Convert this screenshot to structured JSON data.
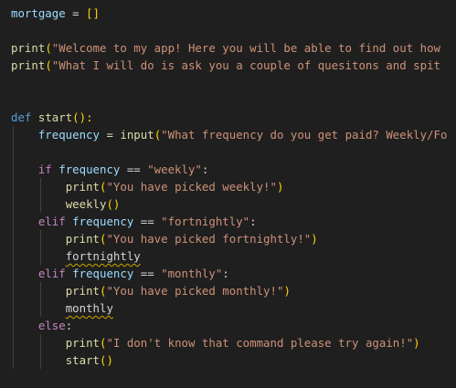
{
  "code": {
    "var_mortgage": "mortgage",
    "op_assign": " = ",
    "list_literal": "[]",
    "kw_print": "print",
    "open_paren": "(",
    "close_paren": ")",
    "str_welcome": "\"Welcome to my app! Here you will be able to find out how",
    "str_what": "\"What I will do is ask you a couple of quesitons and spit",
    "kw_def": "def",
    "fn_start": "start",
    "def_tail": "():",
    "var_frequency": "frequency",
    "kw_input": "input",
    "str_input_prompt": "\"What frequency do you get paid? Weekly/Fo",
    "kw_if": "if",
    "kw_elif": "elif",
    "kw_else": "else",
    "colon": ":",
    "op_eq": " == ",
    "str_weekly": "\"weekly\"",
    "str_fortnightly": "\"fortnightly\"",
    "str_monthly": "\"monthly\"",
    "str_picked_weekly": "\"You have picked weekly!\"",
    "str_picked_fortnightly": "\"You have picked fortnightly!\"",
    "str_picked_monthly": "\"You have picked monthly!\"",
    "fn_weekly": "weekly",
    "call_parens": "()",
    "name_fortnightly": "fortnightly",
    "name_monthly": "monthly",
    "str_unknown": "\"I don't know that command please try again!\""
  }
}
